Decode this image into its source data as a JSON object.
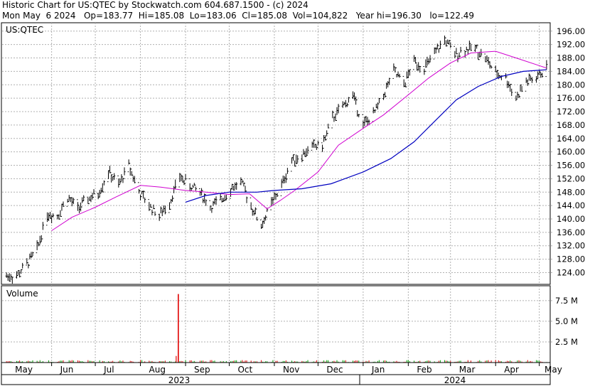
{
  "header": {
    "line1": "Historic Chart for US:QTEC by Stockwatch.com 604.687.1500 - (c) 2024",
    "line2": "Mon May  6 2024   Op=183.77  Hi=185.08  Lo=183.06  Cl=185.08  Vol=104,822   Year hi=196.30   lo=122.49"
  },
  "colors": {
    "bars": "#000000",
    "ma_short": "#d000d0",
    "ma_long": "#0000c0",
    "volume_spike": "#e00000",
    "volume_up": "#00a000",
    "volume_down": "#e00000"
  },
  "chart_data": {
    "type": "line",
    "symbol_label": "US:QTEC",
    "volume_label": "Volume",
    "price_axis": {
      "ticks": [
        "196.00",
        "192.00",
        "188.00",
        "184.00",
        "180.00",
        "176.00",
        "172.00",
        "168.00",
        "164.00",
        "160.00",
        "156.00",
        "152.00",
        "148.00",
        "144.00",
        "140.00",
        "136.00",
        "132.00",
        "128.00",
        "124.00"
      ],
      "range": [
        120.5,
        198.5
      ]
    },
    "volume_axis": {
      "ticks": [
        "7.5 M",
        "5.0 M",
        "2.5 M"
      ],
      "range": [
        0,
        9.3
      ]
    },
    "months": [
      "May",
      "Jun",
      "Jul",
      "Aug",
      "Sep",
      "Oct",
      "Nov",
      "Dec",
      "Jan",
      "Feb",
      "Mar",
      "Apr",
      "May"
    ],
    "years": [
      "2023",
      "2024"
    ],
    "close_by_week": [
      [
        "2023-05-08",
        123.0
      ],
      [
        "2023-05-15",
        126.5
      ],
      [
        "2023-05-22",
        131.0
      ],
      [
        "2023-05-29",
        141.5
      ],
      [
        "2023-06-05",
        141.0
      ],
      [
        "2023-06-12",
        146.5
      ],
      [
        "2023-06-19",
        143.0
      ],
      [
        "2023-06-26",
        146.0
      ],
      [
        "2023-07-03",
        147.5
      ],
      [
        "2023-07-10",
        154.0
      ],
      [
        "2023-07-17",
        150.0
      ],
      [
        "2023-07-24",
        156.0
      ],
      [
        "2023-07-31",
        148.0
      ],
      [
        "2023-08-07",
        144.0
      ],
      [
        "2023-08-14",
        141.0
      ],
      [
        "2023-08-21",
        145.0
      ],
      [
        "2023-08-28",
        152.5
      ],
      [
        "2023-09-04",
        150.0
      ],
      [
        "2023-09-11",
        148.0
      ],
      [
        "2023-09-18",
        143.5
      ],
      [
        "2023-09-25",
        145.5
      ],
      [
        "2023-10-02",
        149.0
      ],
      [
        "2023-10-09",
        151.0
      ],
      [
        "2023-10-16",
        144.0
      ],
      [
        "2023-10-23",
        138.0
      ],
      [
        "2023-10-30",
        144.5
      ],
      [
        "2023-11-06",
        150.0
      ],
      [
        "2023-11-13",
        157.5
      ],
      [
        "2023-11-20",
        159.0
      ],
      [
        "2023-11-27",
        161.5
      ],
      [
        "2023-12-04",
        162.0
      ],
      [
        "2023-12-11",
        170.0
      ],
      [
        "2023-12-18",
        173.5
      ],
      [
        "2023-12-25",
        177.0
      ],
      [
        "2024-01-01",
        168.0
      ],
      [
        "2024-01-08",
        171.0
      ],
      [
        "2024-01-15",
        177.0
      ],
      [
        "2024-01-22",
        184.0
      ],
      [
        "2024-01-29",
        180.0
      ],
      [
        "2024-02-05",
        187.0
      ],
      [
        "2024-02-12",
        185.0
      ],
      [
        "2024-02-19",
        189.0
      ],
      [
        "2024-02-26",
        193.5
      ],
      [
        "2024-03-04",
        189.0
      ],
      [
        "2024-03-11",
        190.5
      ],
      [
        "2024-03-18",
        191.0
      ],
      [
        "2024-03-25",
        188.0
      ],
      [
        "2024-04-01",
        183.5
      ],
      [
        "2024-04-08",
        182.0
      ],
      [
        "2024-04-15",
        176.0
      ],
      [
        "2024-04-22",
        181.0
      ],
      [
        "2024-04-29",
        182.0
      ],
      [
        "2024-05-06",
        185.1
      ]
    ],
    "ma_short_by_week": [
      [
        "2023-06-01",
        136.5
      ],
      [
        "2023-06-15",
        140.5
      ],
      [
        "2023-07-01",
        143.5
      ],
      [
        "2023-07-15",
        146.5
      ],
      [
        "2023-08-01",
        150.0
      ],
      [
        "2023-08-15",
        149.5
      ],
      [
        "2023-09-01",
        148.5
      ],
      [
        "2023-09-15",
        148.0
      ],
      [
        "2023-10-01",
        147.3
      ],
      [
        "2023-10-15",
        147.5
      ],
      [
        "2023-10-27",
        143.0
      ],
      [
        "2023-11-05",
        145.5
      ],
      [
        "2023-11-15",
        148.5
      ],
      [
        "2023-12-01",
        154.0
      ],
      [
        "2023-12-15",
        162.0
      ],
      [
        "2024-01-01",
        167.0
      ],
      [
        "2024-01-15",
        171.0
      ],
      [
        "2024-02-01",
        177.0
      ],
      [
        "2024-02-15",
        182.0
      ],
      [
        "2024-03-01",
        186.5
      ],
      [
        "2024-03-15",
        189.5
      ],
      [
        "2024-04-01",
        190.0
      ],
      [
        "2024-04-15",
        188.0
      ],
      [
        "2024-05-06",
        185.0
      ]
    ],
    "ma_long_by_week": [
      [
        "2023-09-01",
        145.0
      ],
      [
        "2023-09-15",
        147.0
      ],
      [
        "2023-10-01",
        148.0
      ],
      [
        "2023-10-20",
        148.0
      ],
      [
        "2023-11-01",
        148.5
      ],
      [
        "2023-11-20",
        149.0
      ],
      [
        "2023-12-10",
        150.5
      ],
      [
        "2024-01-01",
        154.0
      ],
      [
        "2024-01-20",
        158.0
      ],
      [
        "2024-02-05",
        163.0
      ],
      [
        "2024-02-20",
        169.5
      ],
      [
        "2024-03-05",
        175.5
      ],
      [
        "2024-03-20",
        179.5
      ],
      [
        "2024-04-05",
        182.5
      ],
      [
        "2024-04-20",
        184.0
      ],
      [
        "2024-05-06",
        184.5
      ]
    ],
    "volume_spike": {
      "date": "2023-08-28",
      "value": 8.3,
      "unit": "M"
    }
  }
}
